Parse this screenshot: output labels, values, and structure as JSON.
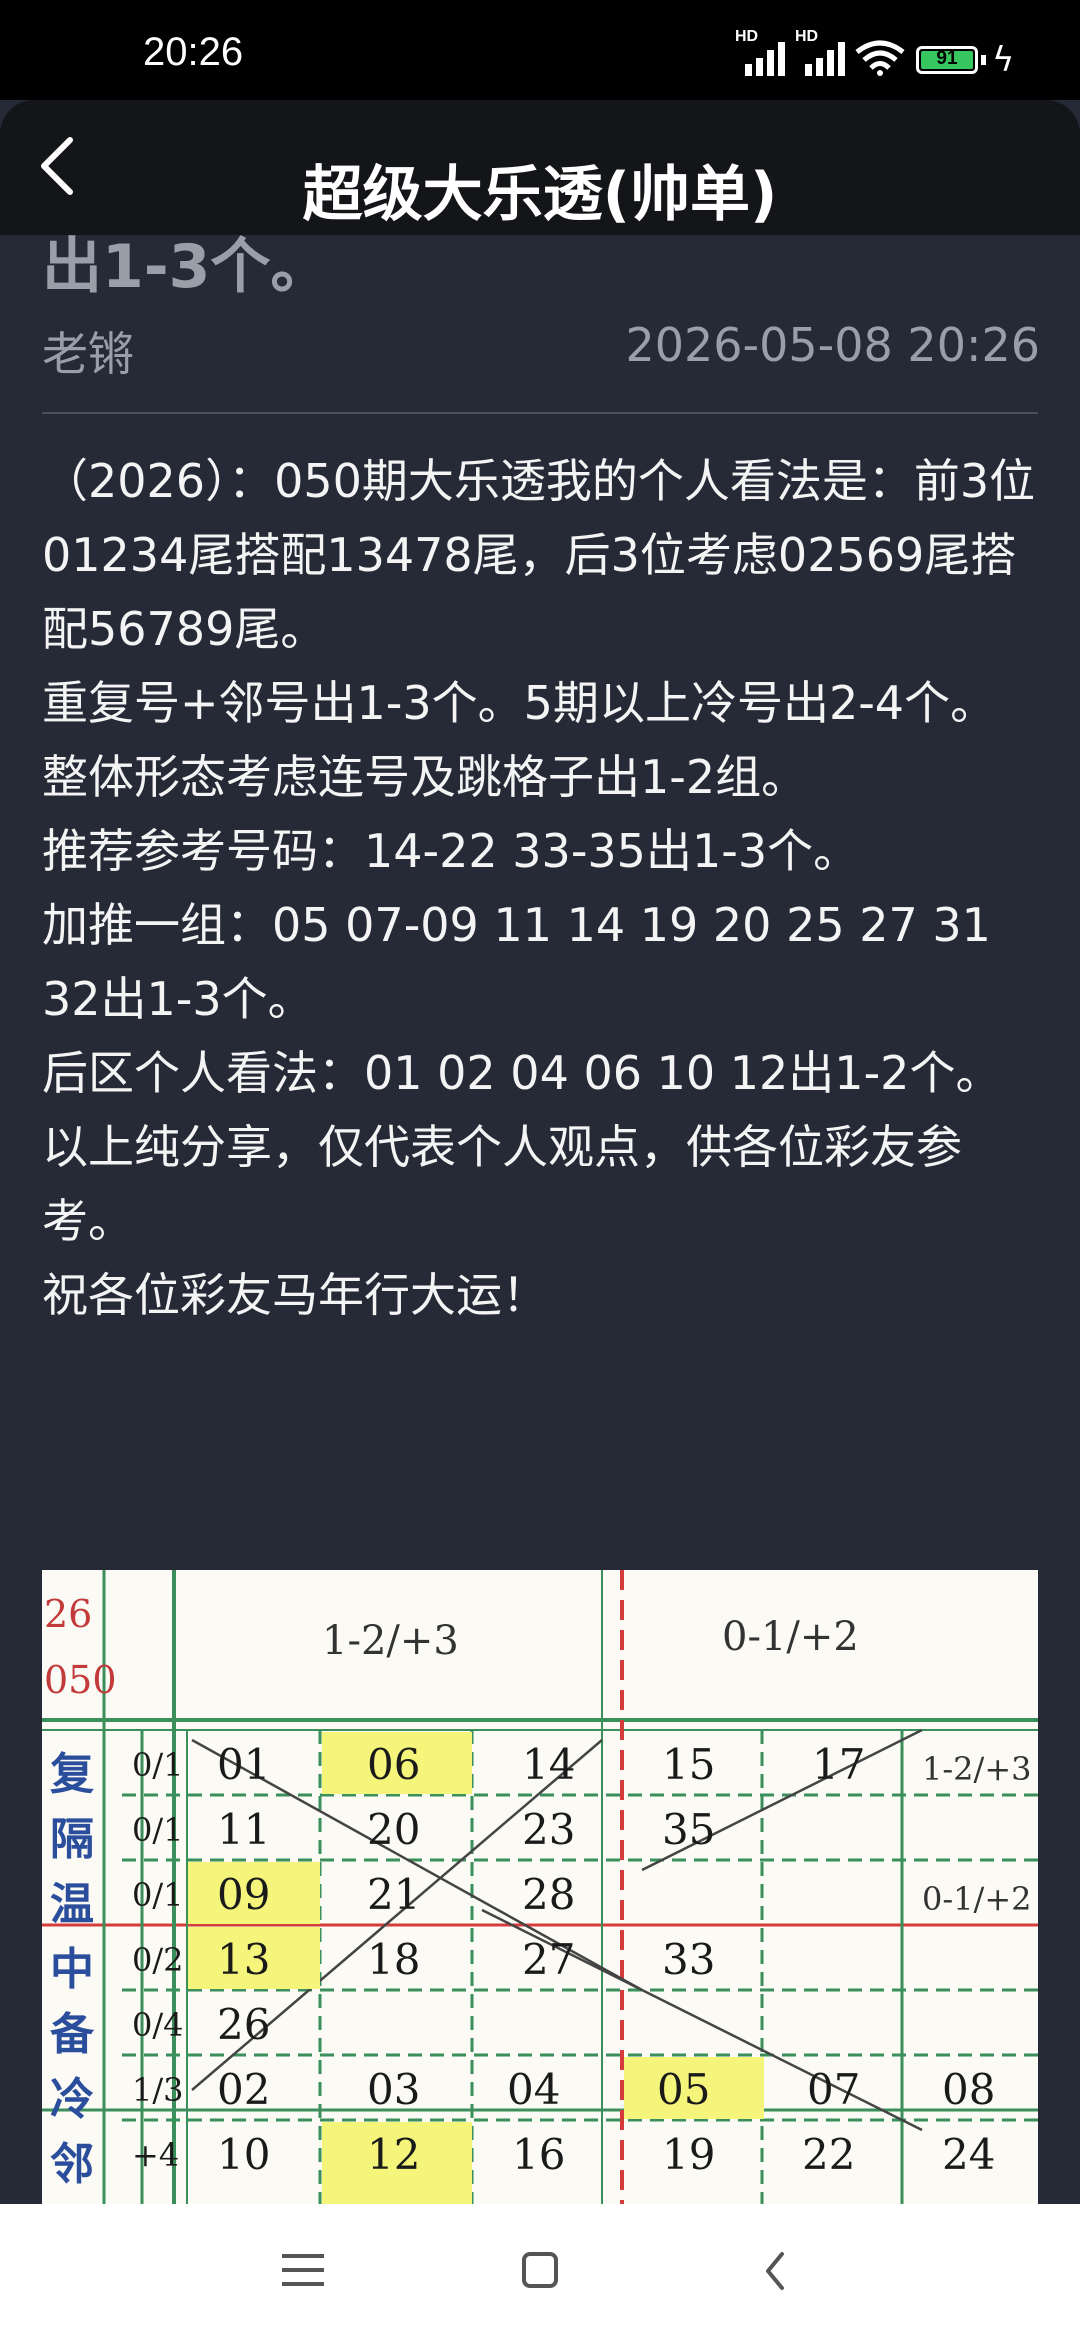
{
  "status_bar": {
    "time": "20:26",
    "signal_1_label": "HD",
    "signal_2_label": "HD",
    "battery": "91",
    "icons": [
      "signal-icon",
      "signal-icon",
      "wifi-icon",
      "battery-icon",
      "charging-icon"
    ]
  },
  "header": {
    "title": "超级大乐透(帅单)",
    "back_icon": "back-arrow-icon"
  },
  "post": {
    "scrolled_text": "出1-3个。",
    "author": "老锵",
    "date": "2026-05-08 20:26",
    "paragraphs": [
      "（2026）：050期大乐透我的个人看法是：前3位01234尾搭配13478尾，后3位考虑02569尾搭配56789尾。",
      "重复号+邻号出1-3个。5期以上冷号出2-4个。",
      "整体形态考虑连号及跳格子出1-2组。",
      "推荐参考号码：14-22 33-35出1-3个。",
      "加推一组：05 07-09 11 14 19 20 25 27 31 32出1-3个。",
      "后区个人看法：01 02 04 06 10 12出1-2个。",
      "以上纯分享，仅代表个人观点，供各位彩友参考。",
      "祝各位彩友马年行大运！"
    ]
  },
  "note_image": {
    "year": "26",
    "issue": "050",
    "top_notes": [
      "1-2/+3",
      "0-1/+2"
    ],
    "side_notes": [
      "1-2/+3",
      "0-1/+2"
    ],
    "rows": [
      {
        "label": "复",
        "ratio": "0/1",
        "cells": [
          "01",
          "06",
          "14",
          "15",
          "17"
        ]
      },
      {
        "label": "隔",
        "ratio": "0/1",
        "cells": [
          "11",
          "20",
          "23",
          "35",
          ""
        ]
      },
      {
        "label": "温",
        "ratio": "0/1",
        "cells": [
          "09",
          "21",
          "28",
          "",
          ""
        ]
      },
      {
        "label": "中",
        "ratio": "0/2",
        "cells": [
          "13",
          "18",
          "27",
          "33",
          ""
        ]
      },
      {
        "label": "备",
        "ratio": "0/4",
        "cells": [
          "26",
          "",
          "",
          "",
          ""
        ]
      },
      {
        "label": "冷",
        "ratio": "1/3",
        "cells": [
          "02",
          "03",
          "04",
          "05",
          "07",
          "08"
        ]
      },
      {
        "label": "邻",
        "ratio": "+4",
        "cells": [
          "10",
          "12",
          "16",
          "19",
          "22",
          "24"
        ]
      }
    ]
  },
  "nav_bar": {
    "icons": [
      "menu-icon",
      "home-icon",
      "back-icon"
    ]
  }
}
